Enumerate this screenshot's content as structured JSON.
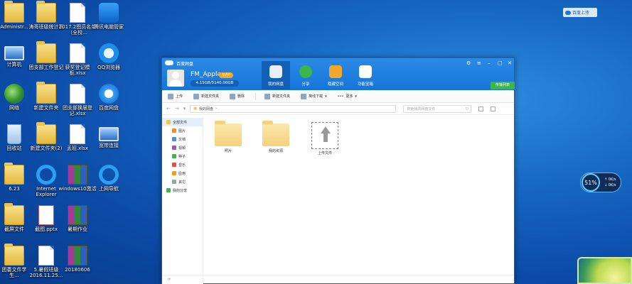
{
  "desktop": {
    "icons": [
      {
        "label": "Administr...",
        "icon": "user-folder-icon"
      },
      {
        "label": "涛哥班级统计表",
        "icon": "folder-icon"
      },
      {
        "label": "2017.2图员名单（全校...",
        "icon": "document-icon"
      },
      {
        "label": "腾讯电脑管家",
        "icon": "shield-icon"
      },
      {
        "label": "计算机",
        "icon": "computer-icon"
      },
      {
        "label": "团支部工作登记",
        "icon": "folder-icon"
      },
      {
        "label": "获奖登记模板.xlsx",
        "icon": "document-icon"
      },
      {
        "label": "QQ浏览器",
        "icon": "qq-browser-icon"
      },
      {
        "label": "网络",
        "icon": "network-icon"
      },
      {
        "label": "新建文件夹",
        "icon": "folder-icon"
      },
      {
        "label": "团支部换届登记.xlsx",
        "icon": "document-icon"
      },
      {
        "label": "百度网盘",
        "icon": "baidu-cloud-icon"
      },
      {
        "label": "回收站",
        "icon": "recycle-bin-icon"
      },
      {
        "label": "新建文件夹(2)",
        "icon": "folder-icon"
      },
      {
        "label": "孟班.xlsx",
        "icon": "document-icon"
      },
      {
        "label": "宽带连接",
        "icon": "broadband-icon"
      },
      {
        "label": "6.23",
        "icon": "folder-icon"
      },
      {
        "label": "Internet Explorer",
        "icon": "ie-icon"
      },
      {
        "label": "windows10激活",
        "icon": "archive-icon"
      },
      {
        "label": "上网导航",
        "icon": "ie-icon"
      },
      {
        "label": "截屏文件",
        "icon": "folder-icon"
      },
      {
        "label": "截图.pptx",
        "icon": "ppt-icon"
      },
      {
        "label": "暑期作业",
        "icon": "archive-icon"
      },
      {
        "label": "",
        "icon": ""
      },
      {
        "label": "团委文件学生...",
        "icon": "folder-icon"
      },
      {
        "label": "5.暑假班级2016.11.25...",
        "icon": "document-icon"
      },
      {
        "label": "20180606",
        "icon": "archive-icon"
      },
      {
        "label": "",
        "icon": ""
      }
    ],
    "topright_widget": "百度上传",
    "speed_ball": {
      "percent": "51%",
      "up": "0K/s",
      "down": "0K/s"
    }
  },
  "baidu_window": {
    "app_title": "百度网盘",
    "user": {
      "name": "FM_Apple",
      "vip": "SVIP",
      "quota": "4.15GB/5140.00GB"
    },
    "nav_tabs": [
      {
        "label": "我的网盘",
        "color": "#ffffff",
        "active": true
      },
      {
        "label": "分享",
        "color": "#3cb54a",
        "active": false
      },
      {
        "label": "隐藏空间",
        "color": "#f2a62a",
        "active": false
      },
      {
        "label": "功能宝箱",
        "color": "#ffffff",
        "active": false
      }
    ],
    "green_button": "传输列表",
    "toolbar": [
      "上传",
      "新建文件夹",
      "删除",
      "新建文件夹",
      "离线下载",
      "更多"
    ],
    "address": {
      "path": "我的网盘",
      "search_placeholder": "搜索我的网盘文件"
    },
    "sidebar": [
      {
        "label": "全部文件",
        "icon": "folder-icon",
        "color": "#f4c542",
        "active": true,
        "sub": false
      },
      {
        "label": "图片",
        "icon": "image-icon",
        "color": "#f28c2e",
        "active": false,
        "sub": true
      },
      {
        "label": "文档",
        "icon": "document-icon",
        "color": "#4a90e2",
        "active": false,
        "sub": true
      },
      {
        "label": "视频",
        "icon": "video-icon",
        "color": "#9b59b6",
        "active": false,
        "sub": true
      },
      {
        "label": "种子",
        "icon": "bt-icon",
        "color": "#3cb54a",
        "active": false,
        "sub": true
      },
      {
        "label": "音乐",
        "icon": "music-icon",
        "color": "#e74c3c",
        "active": false,
        "sub": true
      },
      {
        "label": "应用",
        "icon": "app-icon",
        "color": "#f39c12",
        "active": false,
        "sub": true
      },
      {
        "label": "其它",
        "icon": "other-icon",
        "color": "#95a5a6",
        "active": false,
        "sub": true
      },
      {
        "label": "我的分享",
        "icon": "share-icon",
        "color": "#3cb54a",
        "active": false,
        "sub": false
      }
    ],
    "files": [
      {
        "name": "照片",
        "type": "folder"
      },
      {
        "name": "我的资源",
        "type": "folder"
      },
      {
        "name": "上传文件",
        "type": "upload"
      }
    ]
  }
}
